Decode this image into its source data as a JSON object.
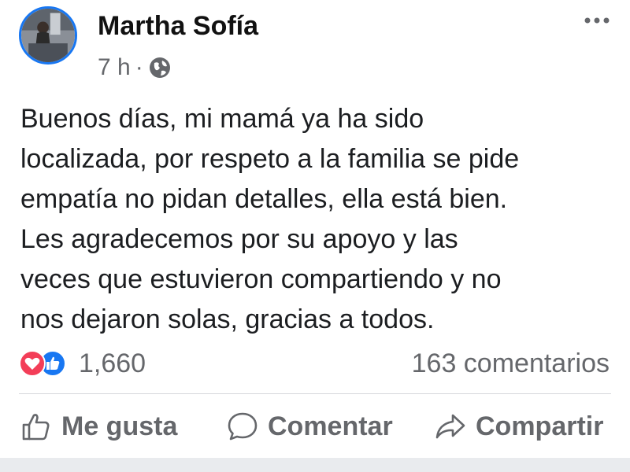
{
  "post": {
    "author": "Martha Sofía",
    "time": "7 h",
    "separator": "·",
    "audience_icon": "globe-icon",
    "more_icon": "more-options-icon",
    "text": "Buenos días, mi mamá ya ha sido\nlocalizada, por respeto a la familia se pide\nempatía no pidan detalles, ella está bien.\nLes agradecemos por su apoyo y las\nveces que estuvieron compartiendo y no\nnos dejaron solas, gracias a todos."
  },
  "engagement": {
    "reaction_icons": [
      "love-icon",
      "like-icon"
    ],
    "reactions_count": "1,660",
    "comments_count": "163 comentarios"
  },
  "actions": {
    "like_label": "Me gusta",
    "comment_label": "Comentar",
    "share_label": "Compartir"
  },
  "colors": {
    "accent": "#1877f2",
    "love": "#f33e58",
    "secondary_text": "#65676b",
    "primary_text": "#1c1e21"
  }
}
